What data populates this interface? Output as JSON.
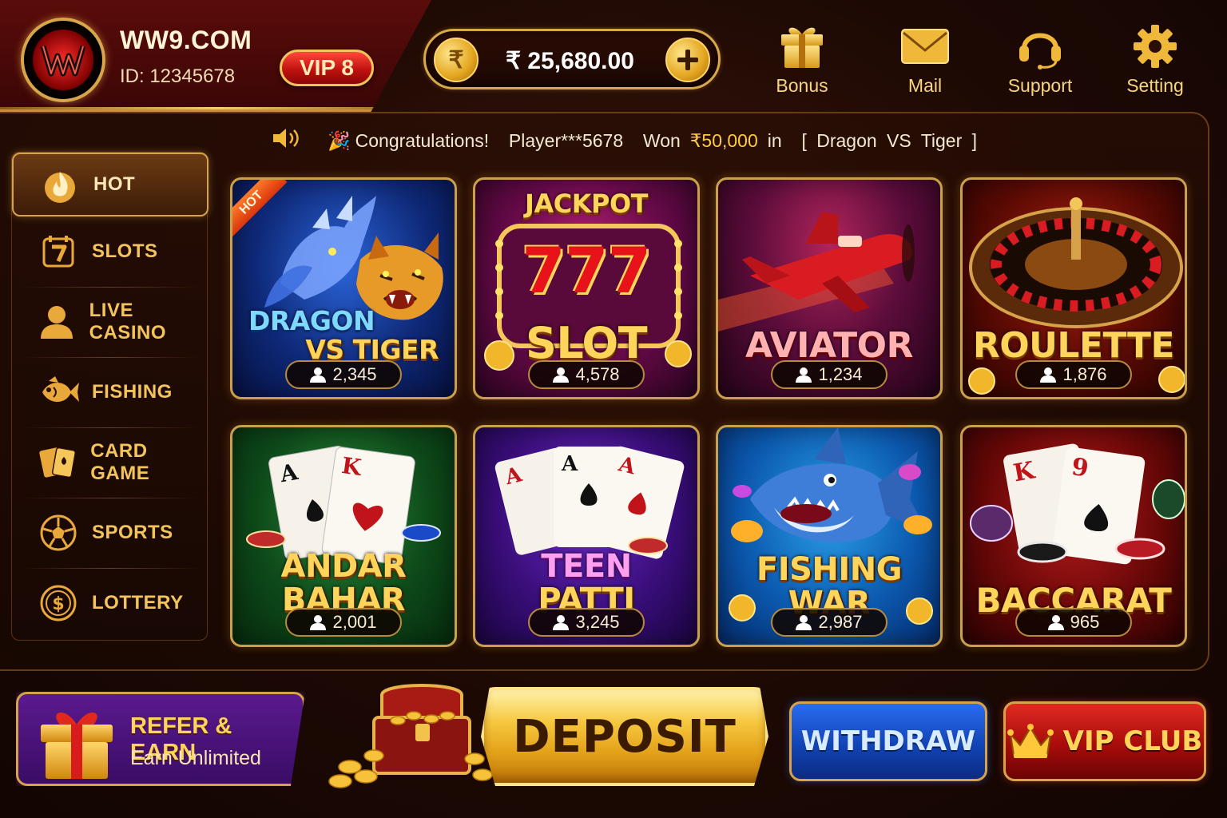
{
  "header": {
    "site_name": "WW9.COM",
    "user_id": "ID: 12345678",
    "vip_level": "VIP 8",
    "balance": "₹ 25,680.00",
    "currency_symbol": "₹",
    "add_icon": "plus-icon",
    "nav": [
      {
        "label": "Bonus",
        "icon": "gift-icon"
      },
      {
        "label": "Mail",
        "icon": "envelope-icon"
      },
      {
        "label": "Support",
        "icon": "headset-icon"
      },
      {
        "label": "Setting",
        "icon": "gear-icon"
      }
    ]
  },
  "ticker": {
    "prefix": "Congratulations!  Player***5678  Won",
    "amount": "₹50,000",
    "suffix": "in  [ Dragon VS Tiger ]"
  },
  "sidebar": {
    "items": [
      {
        "label": "HOT",
        "icon": "flame-icon",
        "active": true
      },
      {
        "label": "SLOTS",
        "icon": "slot-seven-icon"
      },
      {
        "label": "LIVE CASINO",
        "icon": "person-icon"
      },
      {
        "label": "FISHING",
        "icon": "fish-icon"
      },
      {
        "label": "CARD GAME",
        "icon": "cards-icon"
      },
      {
        "label": "SPORTS",
        "icon": "soccer-ball-icon"
      },
      {
        "label": "LOTTERY",
        "icon": "dollar-coin-icon"
      }
    ]
  },
  "games": [
    {
      "title_line1": "DRAGON",
      "title_line2": "VS TIGER",
      "players": "2,345",
      "badge": "HOT"
    },
    {
      "title_top": "JACKPOT",
      "title_mid": "777",
      "title_line1": "SLOT",
      "players": "4,578"
    },
    {
      "title_line1": "AVIATOR",
      "players": "1,234"
    },
    {
      "title_line1": "ROULETTE",
      "players": "1,876"
    },
    {
      "title_line1": "ANDAR",
      "title_line2": "BAHAR",
      "players": "2,001",
      "cards": [
        "A",
        "K"
      ]
    },
    {
      "title_line1": "TEEN",
      "title_line2": "PATTI",
      "players": "3,245",
      "cards": [
        "A",
        "A",
        "A"
      ]
    },
    {
      "title_line1": "FISHING",
      "title_line2": "WAR",
      "players": "2,987"
    },
    {
      "title_line1": "BACCARAT",
      "players": "965",
      "cards": [
        "K",
        "9"
      ]
    }
  ],
  "bottom": {
    "refer_title": "REFER & EARN",
    "refer_subtitle": "Earn Unlimited",
    "deposit": "DEPOSIT",
    "withdraw": "WITHDRAW",
    "vip_club": "VIP CLUB"
  },
  "colors": {
    "gold": "#f7cf62",
    "background": "#1d0904",
    "vip_red": "#c01210",
    "withdraw_blue": "#1244b6",
    "refer_purple": "#3a0c66"
  }
}
